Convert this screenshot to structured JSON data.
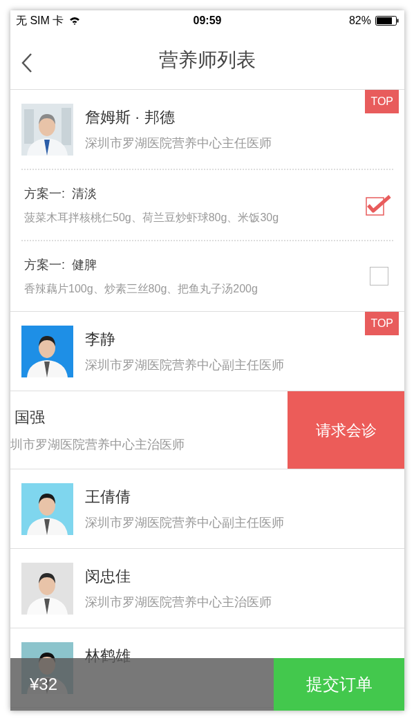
{
  "status_bar": {
    "carrier": "无 SIM 卡",
    "time": "09:59",
    "battery": "82%"
  },
  "nav": {
    "title": "营养师列表"
  },
  "doctors": [
    {
      "kind": "plain",
      "name": "詹姆斯 · 邦德",
      "title": "深圳市罗湖医院营养中心主任医师",
      "top": "TOP",
      "plans": [
        {
          "name": "方案一:  清淡",
          "items": "菠菜木耳拌核桃仁50g、荷兰豆炒虾球80g、米饭30g",
          "checked": true
        },
        {
          "name": "方案一:  健脾",
          "items": "香辣藕片100g、炒素三丝80g、把鱼丸子汤200g",
          "checked": false
        }
      ]
    },
    {
      "kind": "plain",
      "name": "李静",
      "title": "深圳市罗湖医院营养中心副主任医师",
      "top": "TOP"
    },
    {
      "kind": "swiped",
      "name": "国强",
      "title": "圳市罗湖医院营养中心主治医师",
      "action": "请求会诊"
    },
    {
      "kind": "plain",
      "name": "王倩倩",
      "title": "深圳市罗湖医院营养中心副主任医师"
    },
    {
      "kind": "plain",
      "name": "闵忠佳",
      "title": "深圳市罗湖医院营养中心主治医师"
    },
    {
      "kind": "plain",
      "name": "林鹤雄"
    }
  ],
  "bottom_bar": {
    "price": "¥32",
    "submit": "提交订单"
  }
}
